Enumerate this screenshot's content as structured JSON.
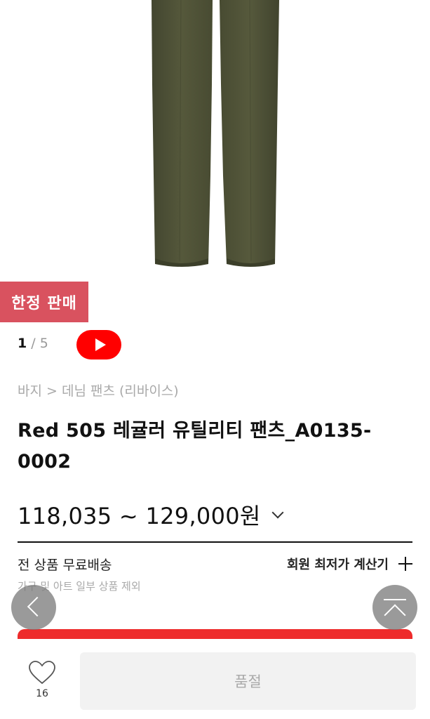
{
  "product": {
    "badge": "한정 판매",
    "pager_current": "1",
    "pager_total": "5",
    "breadcrumb": "바지 > 데님 팬츠 (리바이스)",
    "name": "Red 505 레귤러 유틸리티 팬츠_A0135-0002",
    "price": "118,035 ~ 129,000원"
  },
  "shipping": {
    "title": "전 상품 무료배송",
    "note": "가구 및 아트 일부 상품 제외",
    "calc_label": "회원 최저가 계산기"
  },
  "bottom": {
    "like_count": "16",
    "soldout_label": "품절"
  },
  "colors": {
    "badge": "#d9525f",
    "video": "#ff0000",
    "red_bar": "#ee2b2b",
    "pants": "#4e5136"
  },
  "icons": {
    "video": "play-icon",
    "price_toggle": "chevron-down-icon",
    "calc": "plus-icon",
    "prev": "chevron-left-icon",
    "top": "scroll-top-icon",
    "like": "heart-icon"
  }
}
